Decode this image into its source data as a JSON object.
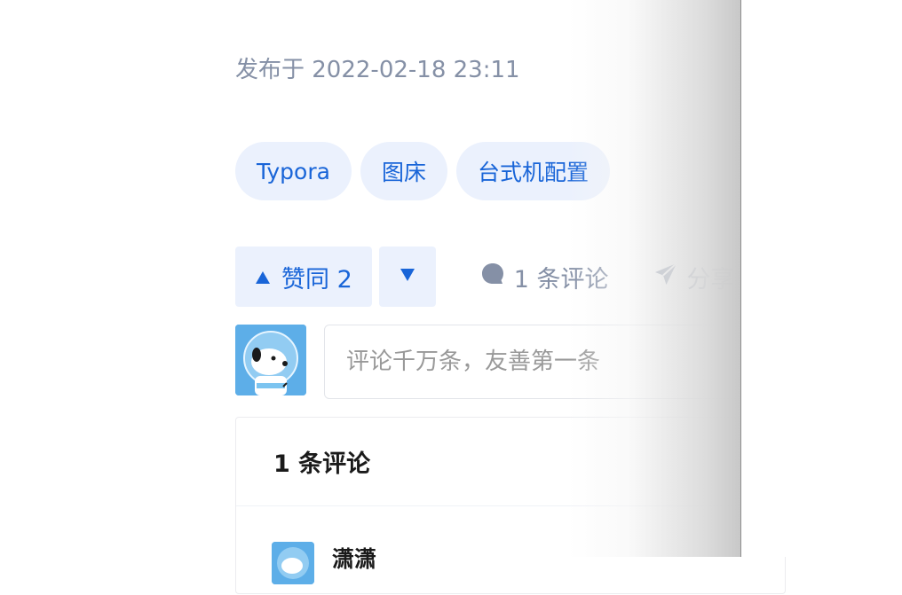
{
  "post": {
    "published_text": "发布于 2022-02-18 23:11"
  },
  "tags": [
    "Typora",
    "图床",
    "台式机配置"
  ],
  "actions": {
    "upvote_label": "赞同 2",
    "comment_label": "1 条评论",
    "share_label": "分享"
  },
  "comment_input": {
    "placeholder": "评论千万条，友善第一条"
  },
  "comments": {
    "header": "1 条评论",
    "items": [
      {
        "author": "潇潇"
      }
    ]
  },
  "colors": {
    "accent": "#1965d8",
    "tag_bg": "#ebf1fd",
    "muted_text": "#8590a6"
  }
}
